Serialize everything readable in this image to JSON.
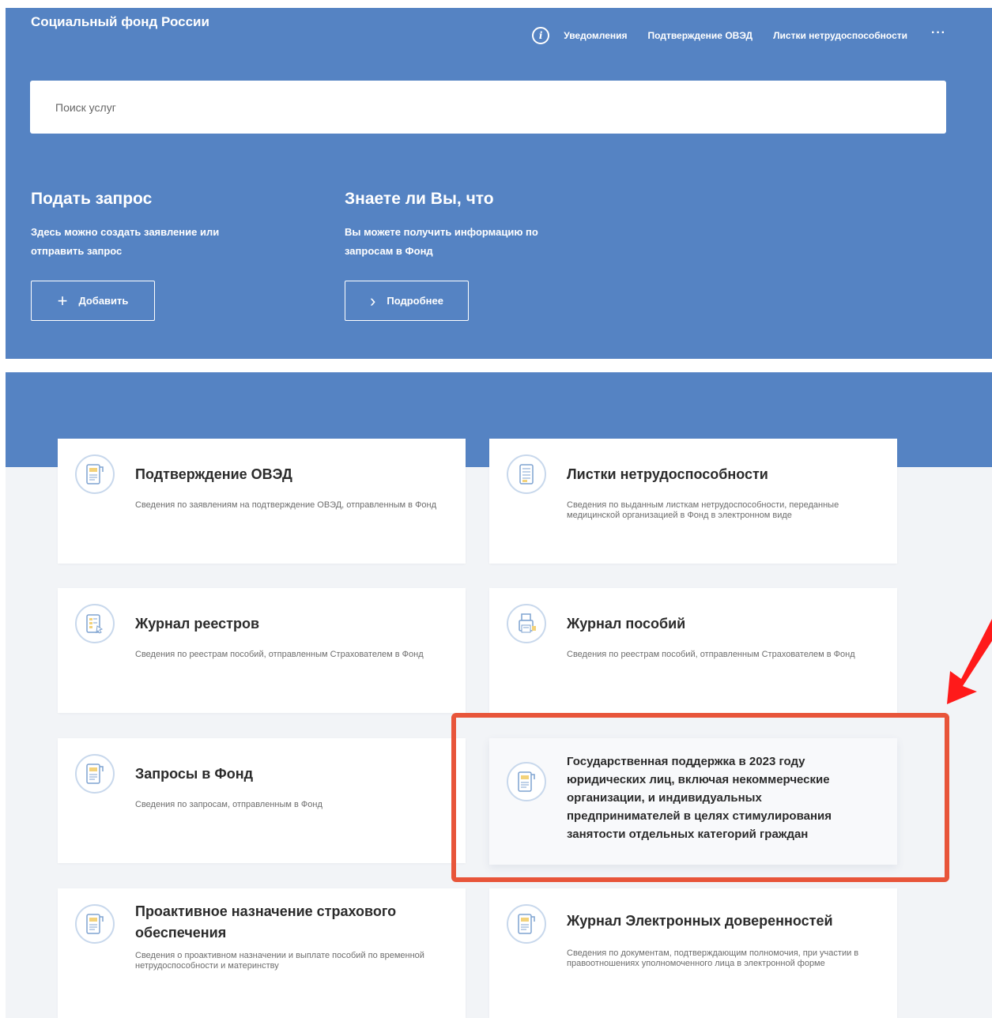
{
  "header": {
    "brand": "Социальный фонд России",
    "nav": [
      "Уведомления",
      "Подтверждение ОВЭД",
      "Листки нетрудоспособности"
    ],
    "more": "···"
  },
  "search": {
    "placeholder": "Поиск услуг"
  },
  "promo": {
    "left": {
      "title": "Подать запрос",
      "text": "Здесь можно создать заявление или отправить запрос",
      "button": "Добавить"
    },
    "right": {
      "title": "Знаете ли Вы, что",
      "text": "Вы можете получить информацию по запросам в Фонд",
      "button": "Подробнее"
    }
  },
  "cards": [
    {
      "title": "Подтверждение ОВЭД",
      "desc": "Сведения по заявлениям на подтверждение ОВЭД, отправленным в Фонд",
      "icon": "document-icon"
    },
    {
      "title": "Листки нетрудоспособности",
      "desc": "Сведения по выданным листкам нетрудоспособности, переданные медицинской организацией в Фонд в электронном виде",
      "icon": "sheet-icon"
    },
    {
      "title": "Журнал реестров",
      "desc": "Сведения по реестрам пособий, отправленным Страхователем в Фонд",
      "icon": "registry-icon"
    },
    {
      "title": "Журнал пособий",
      "desc": "Сведения по реестрам пособий, отправленным Страхователем в Фонд",
      "icon": "printer-icon"
    },
    {
      "title": "Запросы в Фонд",
      "desc": "Сведения по запросам, отправленным в Фонд",
      "icon": "document-icon"
    },
    {
      "title": "Государственная поддержка в 2023 году юридических лиц, включая некоммерческие организации, и индивидуальных предпринимателей в целях стимулирования занятости отдельных категорий граждан",
      "desc": "",
      "icon": "document-icon"
    },
    {
      "title": "Проактивное назначение страхового обеспечения",
      "desc": "Сведения о проактивном назначении и выплате пособий по временной нетрудоспособности и материнству",
      "icon": "document-icon"
    },
    {
      "title": "Журнал Электронных доверенностей",
      "desc": "Сведения по документам, подтверждающим полномочия, при участии в правоотношениях уполномоченного лица в электронной форме",
      "icon": "document-icon"
    }
  ],
  "colors": {
    "primary": "#5583c3",
    "highlight": "#e8553a",
    "arrow": "#ff1a1a"
  }
}
